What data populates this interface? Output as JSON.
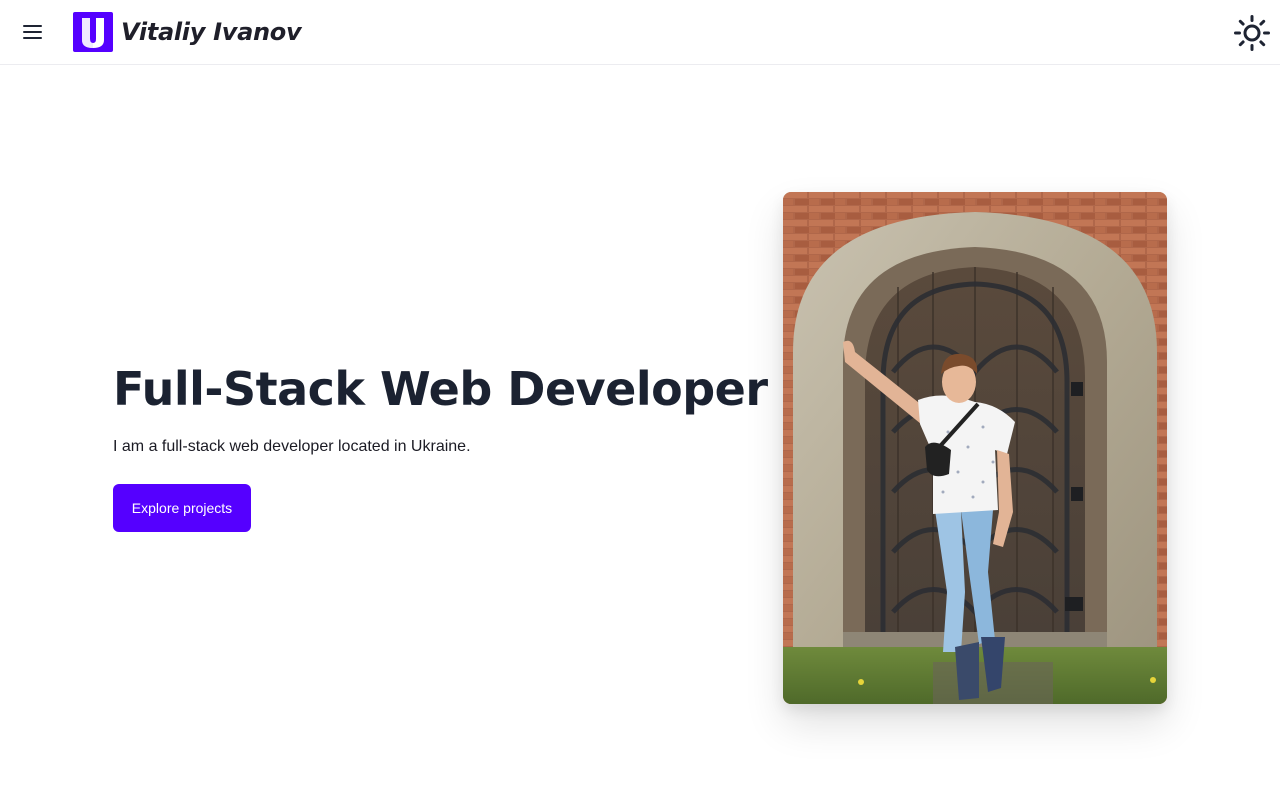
{
  "header": {
    "menu_icon": "hamburger-menu-icon",
    "brand_name": "Vitaliy Ivanov",
    "logo_letter": "V",
    "theme_toggle_icon": "sun-icon"
  },
  "hero": {
    "title": "Full-Stack Web Developer",
    "subtitle": "I am a full-stack web developer located in Ukraine.",
    "cta_label": "Explore projects"
  },
  "colors": {
    "accent": "#5500ff",
    "text": "#1b2231"
  }
}
